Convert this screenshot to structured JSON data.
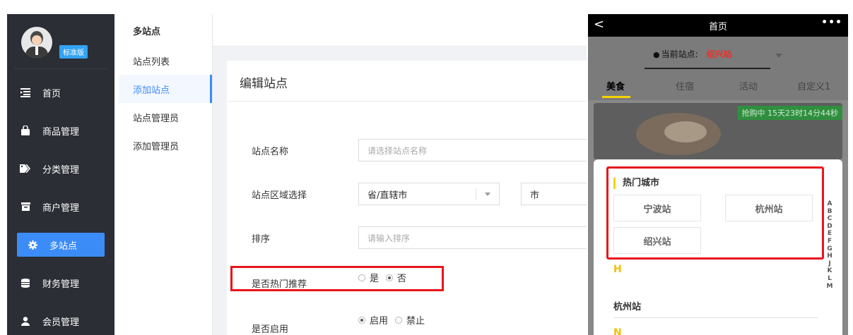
{
  "sidebar": {
    "badge": "标准版",
    "items": [
      {
        "label": "首页",
        "icon": "home-list-icon"
      },
      {
        "label": "商品管理",
        "icon": "bag-icon"
      },
      {
        "label": "分类管理",
        "icon": "tag-icon"
      },
      {
        "label": "商户管理",
        "icon": "store-icon"
      },
      {
        "label": "多站点",
        "icon": "gear-icon",
        "active": true
      },
      {
        "label": "财务管理",
        "icon": "database-icon"
      },
      {
        "label": "会员管理",
        "icon": "user-icon"
      }
    ]
  },
  "subnav": {
    "title": "多站点",
    "items": [
      {
        "label": "站点列表"
      },
      {
        "label": "添加站点",
        "active": true
      },
      {
        "label": "站点管理员"
      },
      {
        "label": "添加管理员"
      }
    ]
  },
  "form": {
    "title": "编辑站点",
    "name_label": "站点名称",
    "name_placeholder": "请选择站点名称",
    "region_label": "站点区域选择",
    "province_value": "省/直辖市",
    "city_value": "市",
    "sort_label": "排序",
    "sort_placeholder": "请输入排序",
    "hot_label": "是否热门推荐",
    "hot_options": [
      "是",
      "否"
    ],
    "hot_selected": "否",
    "enable_label": "是否启用",
    "enable_options": [
      "启用",
      "禁止"
    ],
    "enable_selected": "启用"
  },
  "phone": {
    "back": "<",
    "title": "首页",
    "more": "•••",
    "station_label": "当前站点:",
    "station_value": "绍兴站",
    "tabs": [
      "美食",
      "住宿",
      "活动",
      "自定义1"
    ],
    "active_tab": "美食",
    "timer": "抢购中 15天23时14分44秒",
    "hot_title": "热门城市",
    "hot_cities": [
      "宁波站",
      "杭州站",
      "绍兴站"
    ],
    "letter_h": "H",
    "city_h": "杭州站",
    "letter_n": "N",
    "alphabet": [
      "A",
      "B",
      "C",
      "D",
      "E",
      "F",
      "G",
      "H",
      "J",
      "K",
      "L",
      "M"
    ]
  },
  "colors": {
    "accent": "#3b8cf7",
    "highlight_box": "#e8161c",
    "sidebar_bg": "#2b2e35",
    "tab_accent": "#f5d400"
  }
}
